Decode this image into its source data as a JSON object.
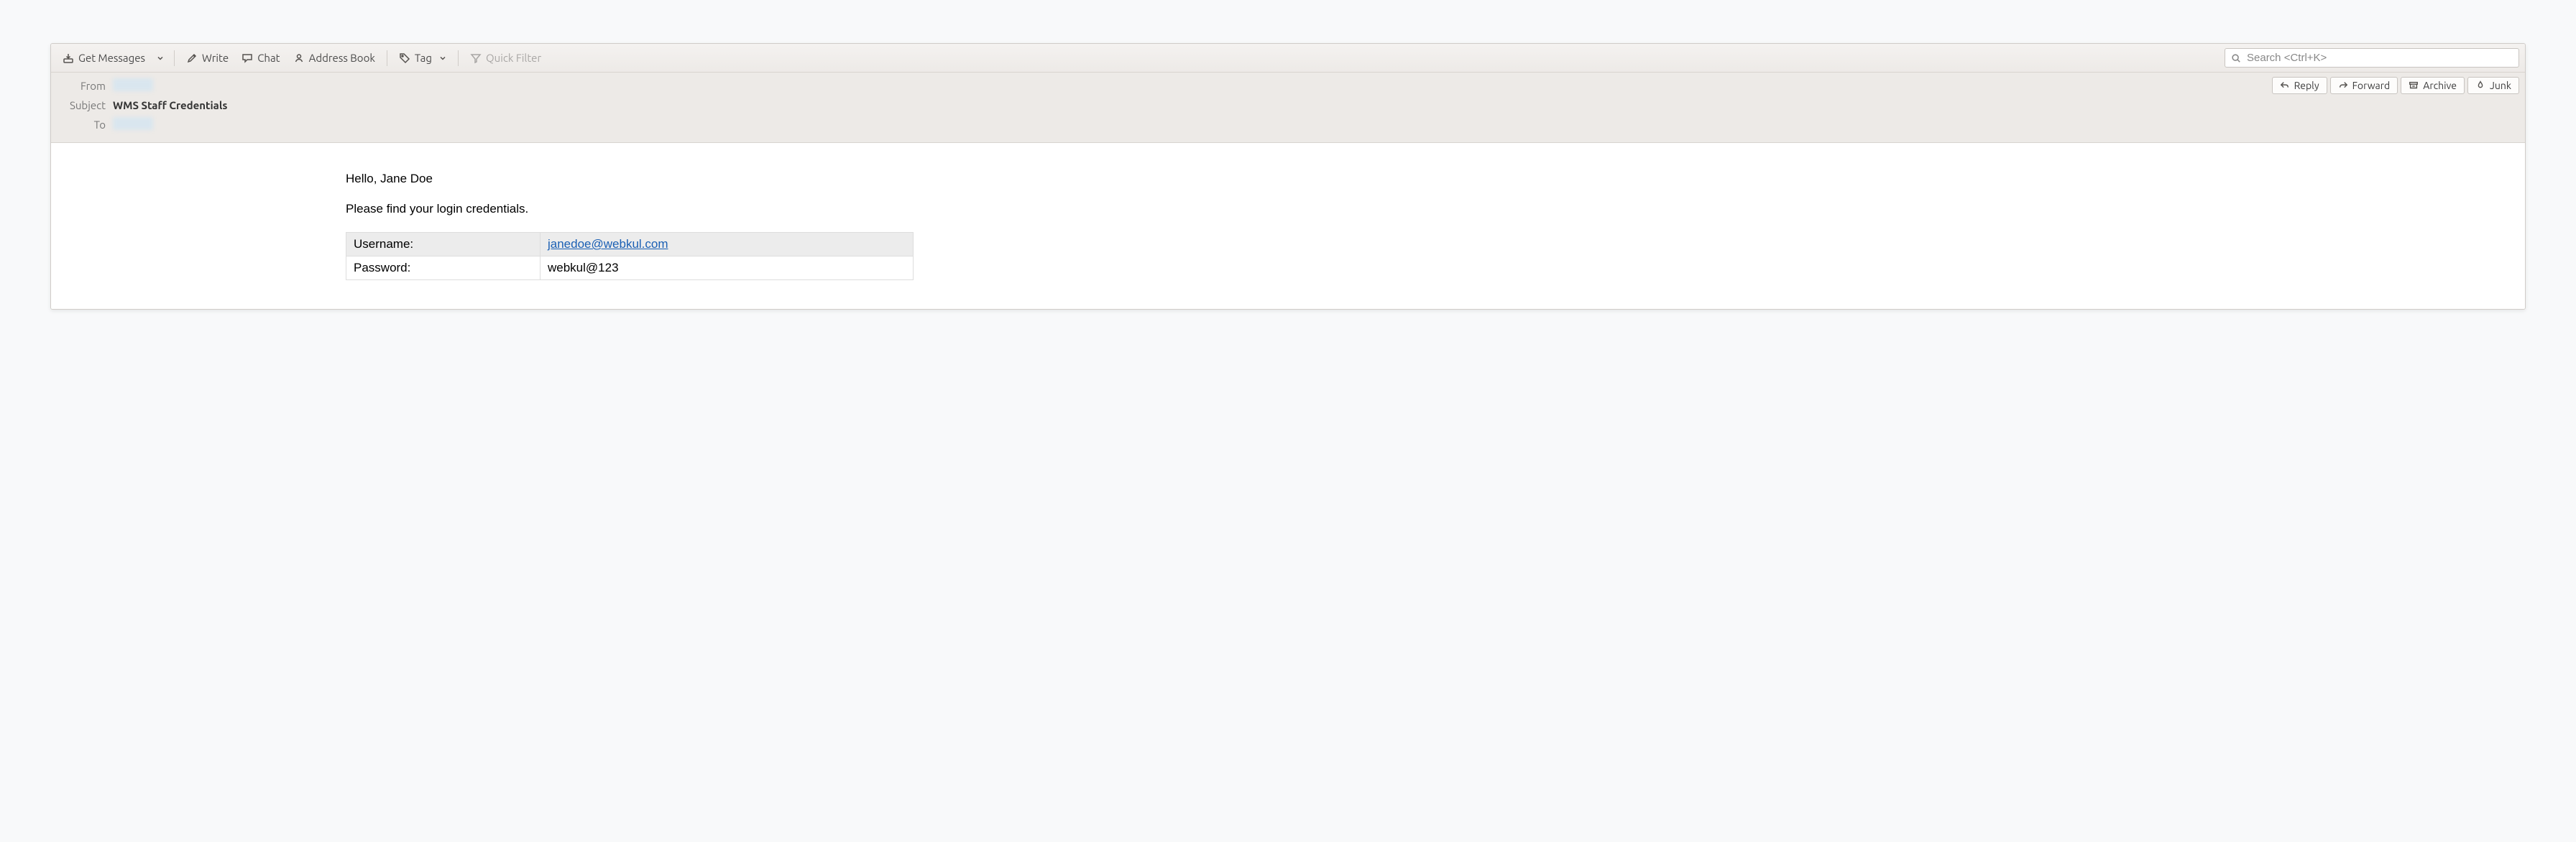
{
  "toolbar": {
    "get_messages": "Get Messages",
    "write": "Write",
    "chat": "Chat",
    "address_book": "Address Book",
    "tag": "Tag",
    "quick_filter": "Quick Filter",
    "search_placeholder": "Search <Ctrl+K>"
  },
  "actions": {
    "reply": "Reply",
    "forward": "Forward",
    "archive": "Archive",
    "junk": "Junk"
  },
  "header": {
    "from_label": "From",
    "subject_label": "Subject",
    "to_label": "To",
    "subject_value": "WMS Staff Credentials"
  },
  "body": {
    "greeting": "Hello, Jane Doe",
    "intro": "Please find your login credentials.",
    "username_label": "Username:",
    "username_value": "janedoe@webkul.com",
    "password_label": "Password:",
    "password_value": "webkul@123"
  }
}
